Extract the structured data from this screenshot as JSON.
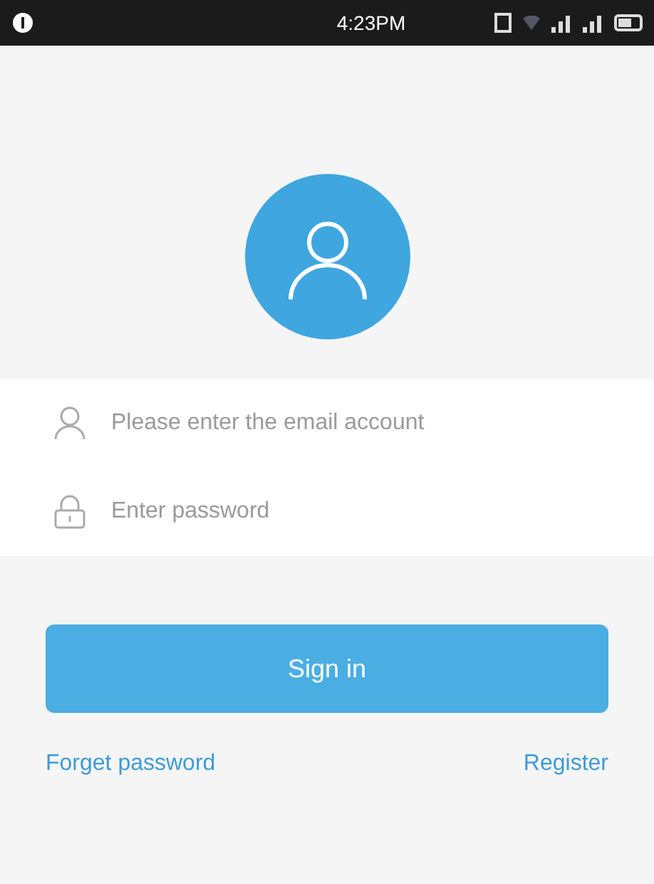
{
  "status_bar": {
    "time": "4:23PM"
  },
  "fields": [
    {
      "kind": "email",
      "placeholder": "Please enter the email account"
    },
    {
      "kind": "password",
      "placeholder": "Enter password"
    }
  ],
  "sign_in_button": "Sign in",
  "links": {
    "forget": "Forget password",
    "register": "Register"
  }
}
